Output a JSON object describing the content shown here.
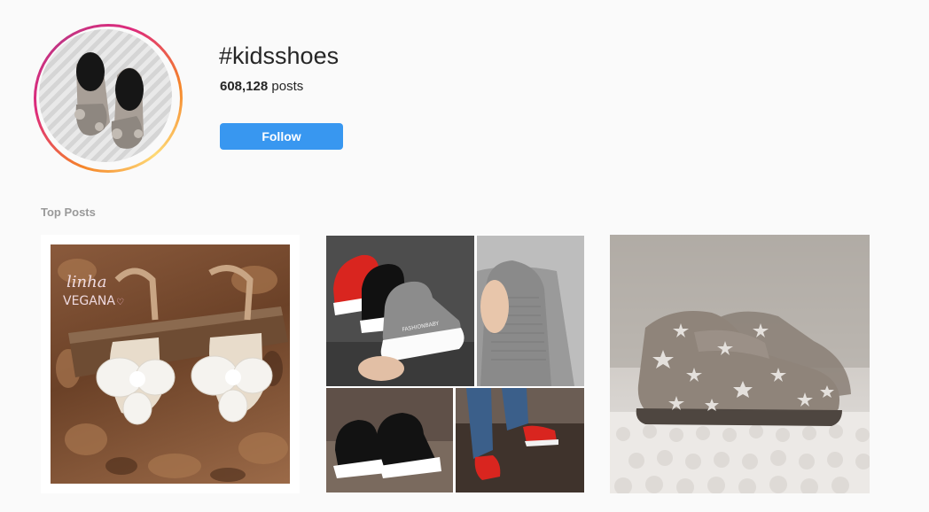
{
  "hashtag": {
    "title": "#kidsshoes",
    "post_count_number": "608,128",
    "post_count_suffix": "posts",
    "follow_label": "Follow"
  },
  "sections": {
    "top_posts_label": "Top Posts"
  },
  "top_posts": [
    {
      "watermark_line1": "linha",
      "watermark_line2": "VEGANA"
    },
    {
      "shoe_label": "FASHIONBABY"
    },
    {}
  ],
  "colors": {
    "accent": "#3897f0",
    "background": "#fafafa",
    "muted_text": "#999999",
    "story_ring_start": "#f58529",
    "story_ring_end": "#c13584"
  }
}
